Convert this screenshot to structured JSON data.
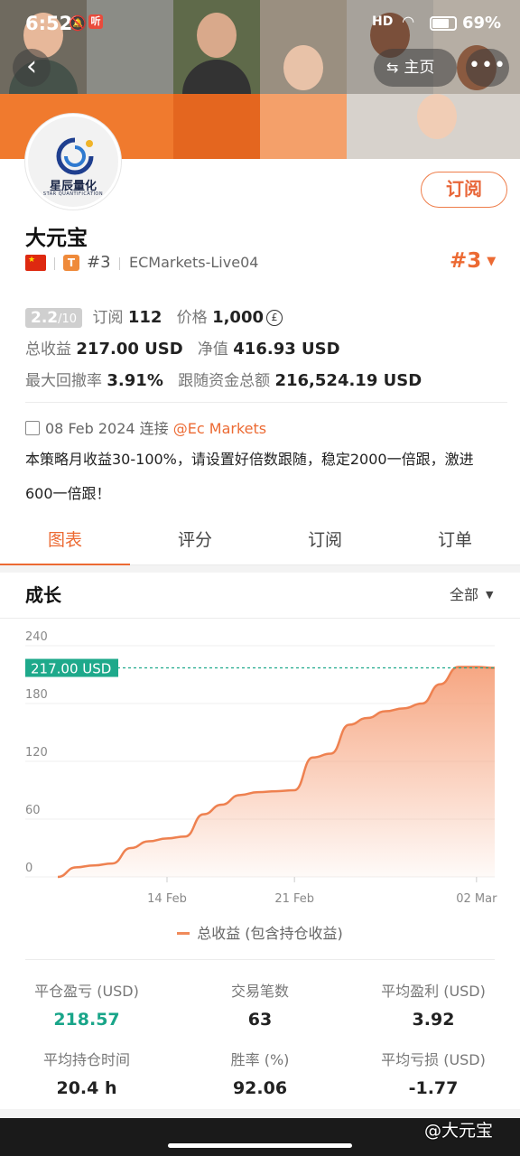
{
  "status_bar": {
    "time": "6:52",
    "notification_badge": "听",
    "signal": "HD",
    "battery": "69%"
  },
  "header": {
    "home_label": "主页",
    "back_icon": "chevron-left-icon",
    "more_icon": "more-dots-icon"
  },
  "profile": {
    "logo_text": "星辰量化",
    "logo_sub": "STAR QUANTIFICATION",
    "name": "大元宝",
    "flag": "CN",
    "tier_badge": "T",
    "rank": "#3",
    "account": "ECMarkets-Live04",
    "rank_right": "#3",
    "subscribe_label": "订阅"
  },
  "stats": {
    "score": "2.2",
    "score_max": "/10",
    "subscribe_label": "订阅",
    "subscribe_count": "112",
    "price_label": "价格",
    "price": "1,000",
    "price_icon": "coin-icon",
    "total_profit_label": "总收益",
    "total_profit": "217.00 USD",
    "net_value_label": "净值",
    "net_value": "416.93 USD",
    "max_drawdown_label": "最大回撤率",
    "max_drawdown": "3.91%",
    "follow_total_label": "跟随资金总额",
    "follow_total": "216,524.19 USD"
  },
  "info": {
    "date": "08 Feb 2024",
    "connect_label": "连接",
    "broker": "@Ec Markets",
    "description": "本策略月收益30-100%，请设置好倍数跟随，稳定2000一倍跟，激进600一倍跟！"
  },
  "tabs": [
    "图表",
    "评分",
    "订阅",
    "订单"
  ],
  "section": {
    "title": "成长",
    "range": "全部"
  },
  "chart_data": {
    "type": "area",
    "x": [
      "08 Feb",
      "09 Feb",
      "10 Feb",
      "11 Feb",
      "12 Feb",
      "13 Feb",
      "14 Feb",
      "15 Feb",
      "16 Feb",
      "17 Feb",
      "18 Feb",
      "19 Feb",
      "20 Feb",
      "21 Feb",
      "22 Feb",
      "23 Feb",
      "24 Feb",
      "25 Feb",
      "26 Feb",
      "27 Feb",
      "28 Feb",
      "29 Feb",
      "01 Mar",
      "02 Mar",
      "03 Mar"
    ],
    "values": [
      0,
      10,
      12,
      14,
      30,
      37,
      40,
      42,
      65,
      75,
      85,
      88,
      89,
      90,
      124,
      128,
      158,
      165,
      172,
      175,
      180,
      200,
      218,
      218,
      217
    ],
    "x_ticks": [
      "14 Feb",
      "21 Feb",
      "02 Mar"
    ],
    "y_ticks": [
      0,
      60,
      120,
      180,
      240
    ],
    "ylim": [
      0,
      240
    ],
    "current_label": "217.00 USD",
    "current_value": 217,
    "series_name": "总收益 (包含持仓收益)",
    "line_color": "#ee8150",
    "fill_color": "#f6a27c",
    "marker_color": "#1ea98b"
  },
  "kpis": [
    {
      "label": "平仓盈亏 (USD)",
      "value": "218.57",
      "green": true
    },
    {
      "label": "交易笔数",
      "value": "63",
      "green": false
    },
    {
      "label": "平均盈利 (USD)",
      "value": "3.92",
      "green": false
    },
    {
      "label": "平均持仓时间",
      "value": "20.4 h",
      "green": false
    },
    {
      "label": "胜率 (%)",
      "value": "92.06",
      "green": false
    },
    {
      "label": "平均亏损 (USD)",
      "value": "-1.77",
      "green": false
    }
  ],
  "watermark": "@大元宝"
}
